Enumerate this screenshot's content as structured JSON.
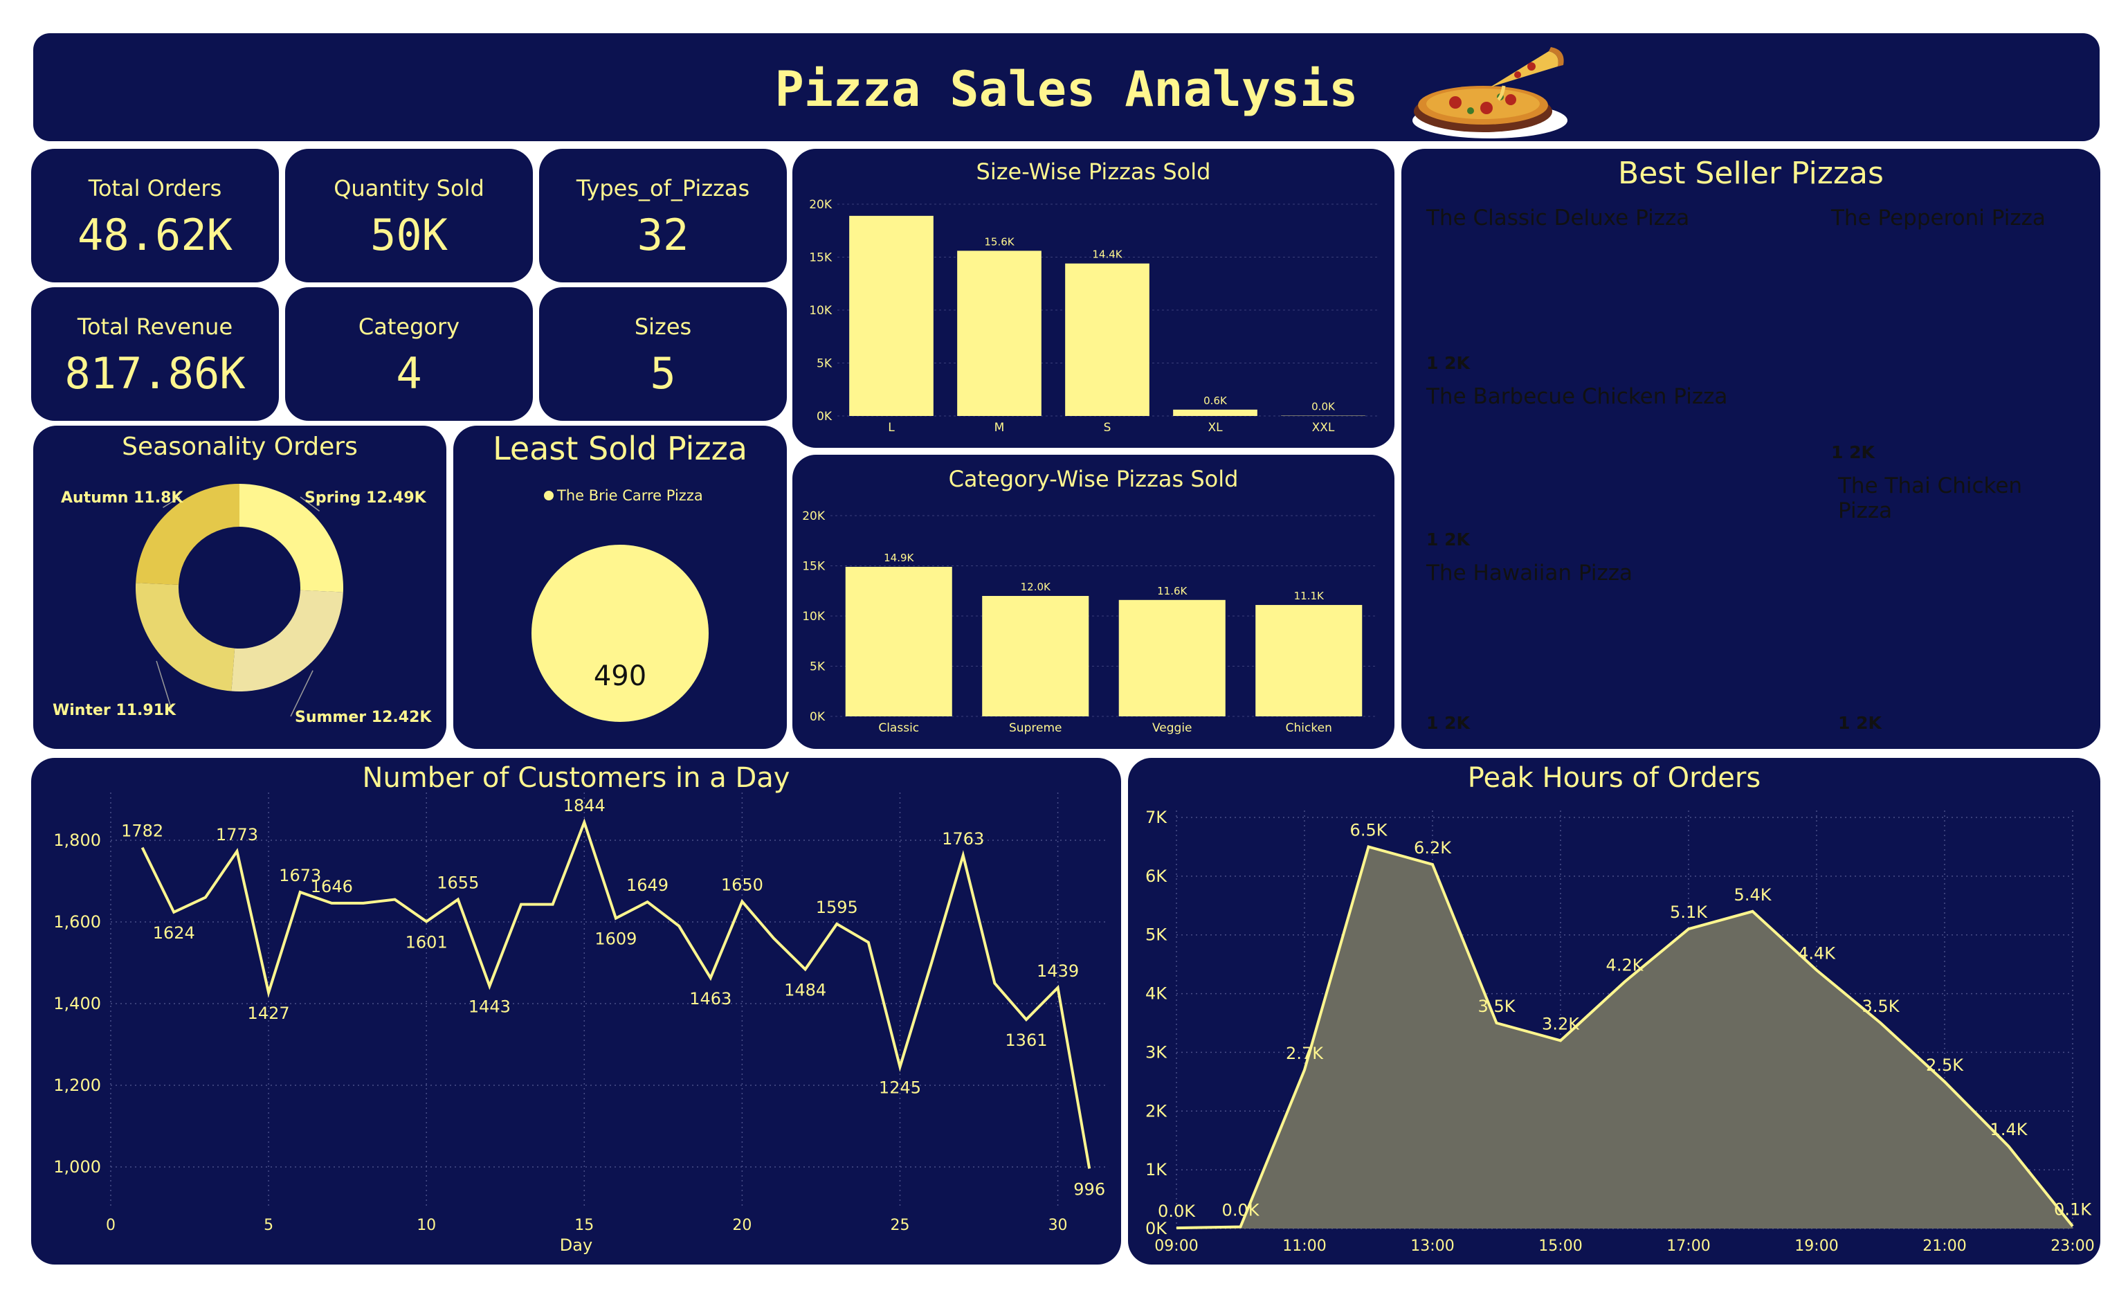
{
  "header": {
    "title": "Pizza Sales Analysis",
    "logo": "pizza-slice-icon"
  },
  "kpis": [
    {
      "label": "Total Orders",
      "value": "48.62K"
    },
    {
      "label": "Quantity Sold",
      "value": "50K"
    },
    {
      "label": "Types_of_Pizzas",
      "value": "32"
    },
    {
      "label": "Total Revenue",
      "value": "817.86K"
    },
    {
      "label": "Category",
      "value": "4"
    },
    {
      "label": "Sizes",
      "value": "5"
    }
  ],
  "colors": {
    "panel": "#0c1250",
    "accent": "#fff68f",
    "area_fill": "#6b6b60"
  },
  "chart_data": [
    {
      "id": "size",
      "type": "bar",
      "title": "Size-Wise Pizzas Sold",
      "categories": [
        "L",
        "M",
        "S",
        "XL",
        "XXL"
      ],
      "values": [
        18900,
        15600,
        14400,
        600,
        28
      ],
      "data_labels": [
        "",
        "15.6K",
        "14.4K",
        "0.6K",
        "0.0K"
      ],
      "ylim": [
        0,
        20000
      ],
      "yticks": [
        0,
        5000,
        10000,
        15000,
        20000
      ],
      "ytick_labels": [
        "0K",
        "5K",
        "10K",
        "15K",
        "20K"
      ]
    },
    {
      "id": "category",
      "type": "bar",
      "title": "Category-Wise Pizzas Sold",
      "categories": [
        "Classic",
        "Supreme",
        "Veggie",
        "Chicken"
      ],
      "values": [
        14900,
        12000,
        11600,
        11100
      ],
      "data_labels": [
        "14.9K",
        "12.0K",
        "11.6K",
        "11.1K"
      ],
      "ylim": [
        0,
        20000
      ],
      "yticks": [
        0,
        5000,
        10000,
        15000,
        20000
      ],
      "ytick_labels": [
        "0K",
        "5K",
        "10K",
        "15K",
        "20K"
      ]
    },
    {
      "id": "season",
      "type": "pie",
      "title": "Seasonality Orders",
      "categories": [
        "Spring",
        "Summer",
        "Winter",
        "Autumn"
      ],
      "values": [
        12490,
        12420,
        11910,
        11800
      ],
      "labels": [
        "Spring 12.49K",
        "Summer 12.42K",
        "Winter 11.91K",
        "Autumn 11.8K"
      ],
      "colors": [
        "#fff68f",
        "#efe3a3",
        "#e9d76e",
        "#e4c84a"
      ]
    },
    {
      "id": "least",
      "type": "pie",
      "title": "Least Sold Pizza",
      "legend": [
        "The Brie Carre Pizza"
      ],
      "values": [
        490
      ],
      "value_label": "490"
    },
    {
      "id": "bestseller",
      "type": "table",
      "title": "Best Seller Pizzas",
      "items": [
        {
          "name": "The Classic Deluxe Pizza",
          "value": "1 2K"
        },
        {
          "name": "The Barbecue Chicken Pizza",
          "value": "1 2K"
        },
        {
          "name": "The Hawaiian Pizza",
          "value": "1 2K"
        },
        {
          "name": "The Pepperoni Pizza",
          "value": "1 2K"
        },
        {
          "name": "The Thai Chicken Pizza",
          "value": "1 2K"
        }
      ],
      "cell_colors": [
        "#fff9d6",
        "#fff8c2",
        "#fff59c",
        "#fff25f",
        "#fff230"
      ]
    },
    {
      "id": "daily",
      "type": "line",
      "title": "Number of Customers in a Day",
      "xlabel": "Day",
      "x": [
        1,
        2,
        3,
        4,
        5,
        6,
        7,
        8,
        9,
        10,
        11,
        12,
        13,
        14,
        15,
        16,
        17,
        18,
        19,
        20,
        21,
        22,
        23,
        24,
        25,
        26,
        27,
        28,
        29,
        30,
        31
      ],
      "values": [
        1782,
        1624,
        1660,
        1773,
        1427,
        1673,
        1646,
        1646,
        1655,
        1601,
        1655,
        1443,
        1643,
        1643,
        1844,
        1609,
        1649,
        1590,
        1463,
        1650,
        1560,
        1484,
        1595,
        1550,
        1245,
        1500,
        1763,
        1450,
        1361,
        1439,
        996
      ],
      "point_labels": [
        "1782",
        "1624",
        "",
        "1773",
        "1427",
        "1673",
        "1646",
        "",
        "",
        "1601",
        "1655",
        "1443",
        "",
        "",
        "1844",
        "1609",
        "1649",
        "",
        "1463",
        "1650",
        "",
        "1484",
        "1595",
        "",
        "1245",
        "",
        "1763",
        "",
        "1361",
        "1439",
        "996"
      ],
      "xlim": [
        0,
        31.5
      ],
      "xticks": [
        0,
        5,
        10,
        15,
        20,
        25,
        30
      ],
      "ylim": [
        900,
        1900
      ],
      "yticks": [
        1000,
        1200,
        1400,
        1600,
        1800
      ],
      "ytick_labels": [
        "1,000",
        "1,200",
        "1,400",
        "1,600",
        "1,800"
      ]
    },
    {
      "id": "hourly",
      "type": "area",
      "title": "Peak Hours of Orders",
      "x": [
        9,
        10,
        11,
        12,
        13,
        14,
        15,
        16,
        17,
        18,
        19,
        20,
        21,
        22,
        23
      ],
      "values": [
        10,
        30,
        2700,
        6500,
        6200,
        3500,
        3200,
        4200,
        5100,
        5400,
        4400,
        3500,
        2500,
        1400,
        40
      ],
      "point_labels": [
        "0.0K",
        "0.0K",
        "2.7K",
        "6.5K",
        "6.2K",
        "3.5K",
        "3.2K",
        "4.2K",
        "5.1K",
        "5.4K",
        "4.4K",
        "3.5K",
        "2.5K",
        "1.4K",
        "0.1K"
      ],
      "xlim": [
        9,
        23
      ],
      "xticks": [
        9,
        11,
        13,
        15,
        17,
        19,
        21,
        23
      ],
      "xtick_labels": [
        "09:00",
        "11:00",
        "13:00",
        "15:00",
        "17:00",
        "19:00",
        "21:00",
        "23:00"
      ],
      "ylim": [
        0,
        7000
      ],
      "yticks": [
        0,
        1000,
        2000,
        3000,
        4000,
        5000,
        6000,
        7000
      ],
      "ytick_labels": [
        "0K",
        "1K",
        "2K",
        "3K",
        "4K",
        "5K",
        "6K",
        "7K"
      ]
    }
  ]
}
